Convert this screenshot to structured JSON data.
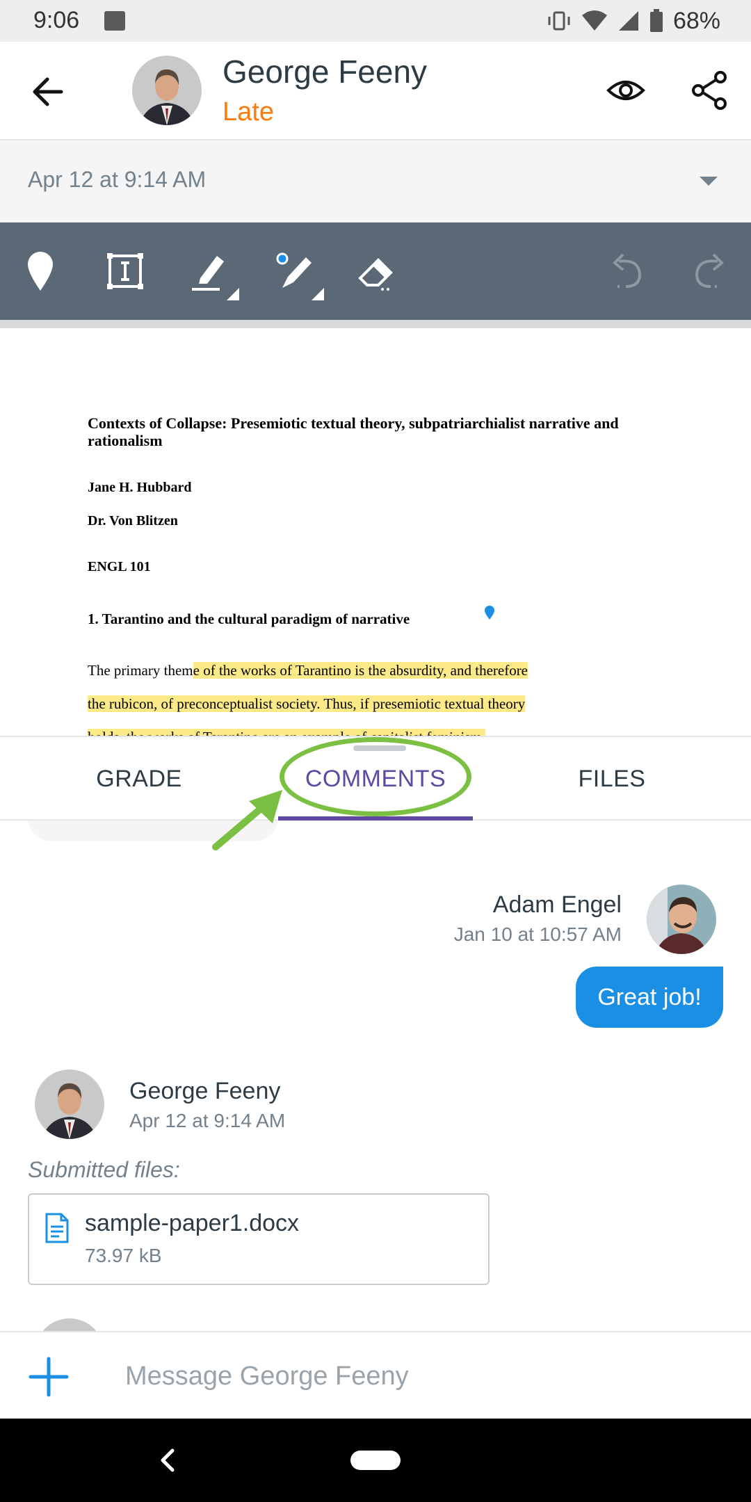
{
  "status_bar": {
    "time": "9:06",
    "battery": "68%"
  },
  "header": {
    "name": "George Feeny",
    "status": "Late"
  },
  "attempt": {
    "selected": "Apr 12 at 9:14 AM"
  },
  "document": {
    "title": "Contexts of Collapse: Presemiotic textual theory, subpatriarchialist narrative and rationalism",
    "author": "Jane H. Hubbard",
    "instructor": "Dr. Von Blitzen",
    "course": "ENGL 101",
    "heading": "1. Tarantino and the cultural paradigm of narrative",
    "line1_plain": "The primary them",
    "line1_highlight": "e of the works of Tarantino is the absurdity, and therefore",
    "line2_highlight": "the rubicon, of preconceptualist society. Thus, if presemiotic textual theory",
    "line3_highlight": "holds, the works of Tarantino are an example of capitalist feminism."
  },
  "tabs": {
    "grade": "GRADE",
    "comments": "COMMENTS",
    "files": "FILES"
  },
  "comments": [
    {
      "author": "Adam Engel",
      "date": "Jan 10 at 10:57 AM",
      "message": "Great job!"
    },
    {
      "author": "George Feeny",
      "date": "Apr 12 at 9:14 AM"
    }
  ],
  "submission": {
    "label": "Submitted files:",
    "file_name": "sample-paper1.docx",
    "file_size": "73.97 kB"
  },
  "message_bar": {
    "placeholder": "Message George Feeny"
  },
  "colors": {
    "accent": "#5e4aa0",
    "late": "#fc7b09",
    "bubble": "#1a8fe3",
    "toolbar": "#5b6976",
    "highlight": "#fcea88",
    "callout": "#7bc043"
  },
  "icons": {
    "back": "arrow-left-icon",
    "eye": "eye-icon",
    "share": "share-icon",
    "pin": "pin-icon",
    "text": "text-box-icon",
    "highlighter": "highlighter-icon",
    "ink": "ink-pen-icon",
    "eraser": "eraser-icon",
    "undo": "undo-icon",
    "redo": "redo-icon",
    "file": "document-icon",
    "add": "plus-icon"
  }
}
